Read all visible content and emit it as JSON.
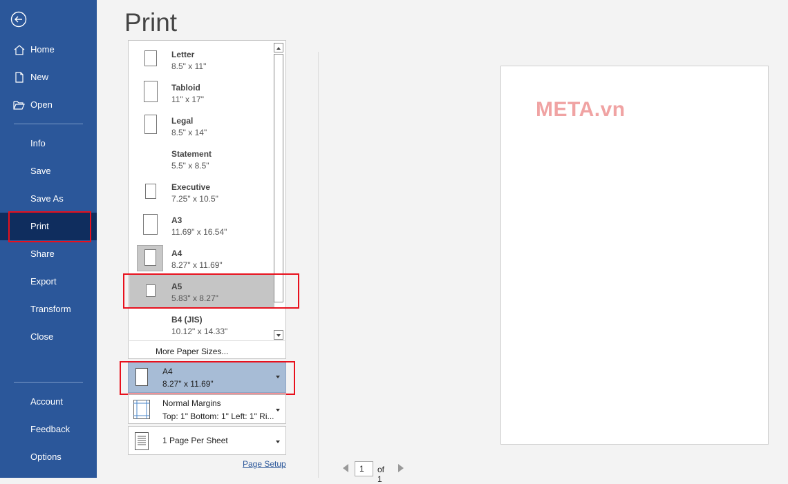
{
  "page_title": "Print",
  "nav": {
    "home": "Home",
    "new": "New",
    "open": "Open",
    "info": "Info",
    "save": "Save",
    "save_as": "Save As",
    "print": "Print",
    "share": "Share",
    "export": "Export",
    "transform": "Transform",
    "close": "Close",
    "account": "Account",
    "feedback": "Feedback",
    "options": "Options"
  },
  "paper_sizes": [
    {
      "name": "Letter",
      "dims": "8.5\" x 11\""
    },
    {
      "name": "Tabloid",
      "dims": "11\" x 17\""
    },
    {
      "name": "Legal",
      "dims": "8.5\" x 14\""
    },
    {
      "name": "Statement",
      "dims": "5.5\" x 8.5\""
    },
    {
      "name": "Executive",
      "dims": "7.25\" x 10.5\""
    },
    {
      "name": "A3",
      "dims": "11.69\" x 16.54\""
    },
    {
      "name": "A4",
      "dims": "8.27\" x 11.69\""
    },
    {
      "name": "A5",
      "dims": "5.83\" x 8.27\""
    },
    {
      "name": "B4 (JIS)",
      "dims": "10.12\" x 14.33\""
    }
  ],
  "more_paper_sizes": "More Paper Sizes...",
  "selected_paper": {
    "name": "A4",
    "dims": "8.27\" x 11.69\""
  },
  "margins": {
    "name": "Normal Margins",
    "detail": "Top: 1\" Bottom: 1\" Left: 1\" Ri..."
  },
  "pages_per_sheet": "1 Page Per Sheet",
  "page_setup_link": "Page Setup",
  "preview": {
    "watermark": "META.vn"
  },
  "pager": {
    "current_page": "1",
    "total": "of 1"
  },
  "colors": {
    "sidebar": "#2b579a",
    "sidebar_active": "#0f2d5e",
    "highlight_box": "#e8101c",
    "selected_setting": "#a7bcd6"
  }
}
